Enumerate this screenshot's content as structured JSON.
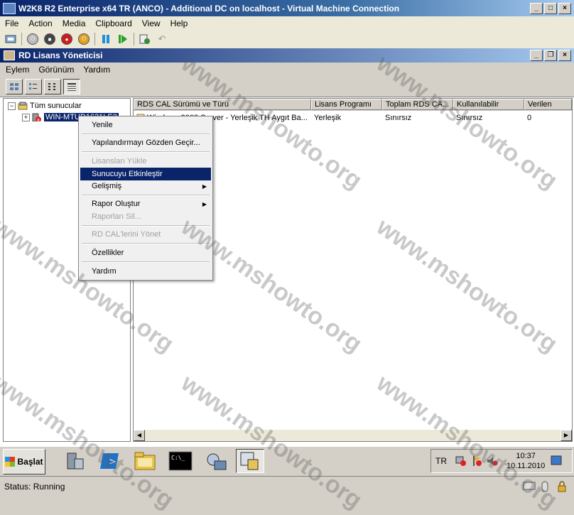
{
  "vm_window": {
    "title": "W2K8 R2 Enterprise x64 TR (ANCO) - Additional DC on localhost - Virtual Machine Connection",
    "menu": [
      "File",
      "Action",
      "Media",
      "Clipboard",
      "View",
      "Help"
    ]
  },
  "rd_window": {
    "title": "RD Lisans Yöneticisi",
    "menu": [
      "Eylem",
      "Görünüm",
      "Yardım"
    ]
  },
  "tree": {
    "root_label": "Tüm sunucular",
    "server_label": "WIN-MTUD1631LE3"
  },
  "list": {
    "columns": [
      "RDS CAL Sürümü ve Türü",
      "Lisans Programı",
      "Toplam RDS CA...",
      "Kullanılabilir",
      "Verilen"
    ],
    "rows": [
      [
        "Windows 2008 Server - Yerleşik TH Aygıt Ba...",
        "Yerleşik",
        "Sınırsız",
        "Sınırsız",
        "0"
      ]
    ]
  },
  "context_menu": {
    "items": [
      {
        "label": "Yenile",
        "disabled": false
      },
      {
        "label": "Yapılandırmayı Gözden Geçir...",
        "disabled": false
      },
      {
        "label": "Lisansları Yükle",
        "disabled": true
      },
      {
        "label": "Sunucuyu Etkinleştir",
        "disabled": false,
        "highlighted": true
      },
      {
        "label": "Gelişmiş",
        "disabled": false,
        "submenu": true
      },
      {
        "label": "Rapor Oluştur",
        "disabled": false,
        "submenu": true
      },
      {
        "label": "Raporları Sil...",
        "disabled": true
      },
      {
        "label": "RD CAL'lerini Yönet",
        "disabled": true
      },
      {
        "label": "Özellikler",
        "disabled": false
      },
      {
        "label": "Yardım",
        "disabled": false
      }
    ]
  },
  "taskbar": {
    "start_label": "Başlat",
    "language": "TR",
    "time": "10:37",
    "date": "10.11.2010"
  },
  "status": {
    "text": "Status: Running"
  },
  "watermark": "www.mshowto.org",
  "colors": {
    "title_gradient_start": "#0a246a",
    "selection": "#0a246a",
    "menu_background": "#f0f0f0"
  }
}
